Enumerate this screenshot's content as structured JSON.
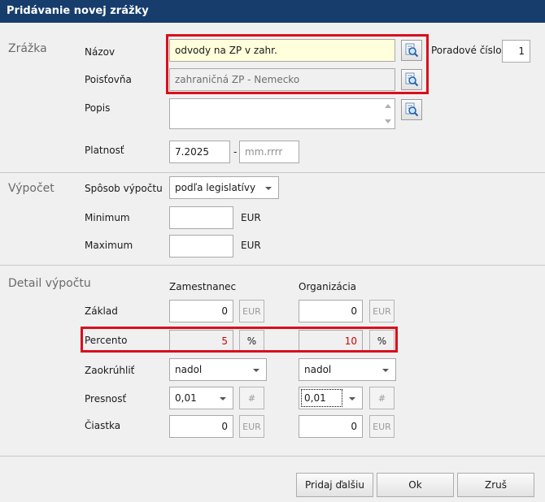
{
  "window": {
    "title": "Pridávanie novej zrážky"
  },
  "sections": {
    "zrazka": "Zrážka",
    "vypocet": "Výpočet",
    "detail": "Detail výpočtu"
  },
  "fields": {
    "nazov_label": "Názov",
    "nazov_value": "odvody na ZP v zahr.",
    "poistovna_label": "Poisťovňa",
    "poistovna_value": "zahraničná ZP - Nemecko",
    "poradove_label": "Poradové číslo",
    "poradove_value": "1",
    "popis_label": "Popis",
    "popis_value": "",
    "platnost_label": "Platnosť",
    "platnost_from": "7.2025",
    "platnost_sep": "-",
    "platnost_to_placeholder": "mm.rrrr",
    "sposob_label": "Spôsob výpočtu",
    "sposob_value": "podľa legislatívy",
    "minimum_label": "Minimum",
    "minimum_value": "",
    "maximum_label": "Maximum",
    "maximum_value": "",
    "currency": "EUR"
  },
  "detail": {
    "col_employee": "Zamestnanec",
    "col_org": "Organizácia",
    "rows": {
      "zaklad": {
        "label": "Základ",
        "employee": "0",
        "org": "0",
        "unit": "EUR"
      },
      "percento": {
        "label": "Percento",
        "employee": "5",
        "org": "10",
        "unit": "%"
      },
      "zaokruhlit": {
        "label": "Zaokrúhliť",
        "employee": "nadol",
        "org": "nadol"
      },
      "presnost": {
        "label": "Presnosť",
        "employee": "0,01",
        "org": "0,01",
        "unit": "#"
      },
      "ciastka": {
        "label": "Čiastka",
        "employee": "0",
        "org": "0",
        "unit": "EUR"
      }
    }
  },
  "buttons": {
    "add_another": "Pridaj ďalšiu",
    "ok": "Ok",
    "cancel": "Zruš"
  },
  "icons": {
    "lookup": "search-icon"
  },
  "colors": {
    "title_bg": "#163d6b",
    "highlight": "#d90f1d",
    "percent_text": "#d40000"
  }
}
